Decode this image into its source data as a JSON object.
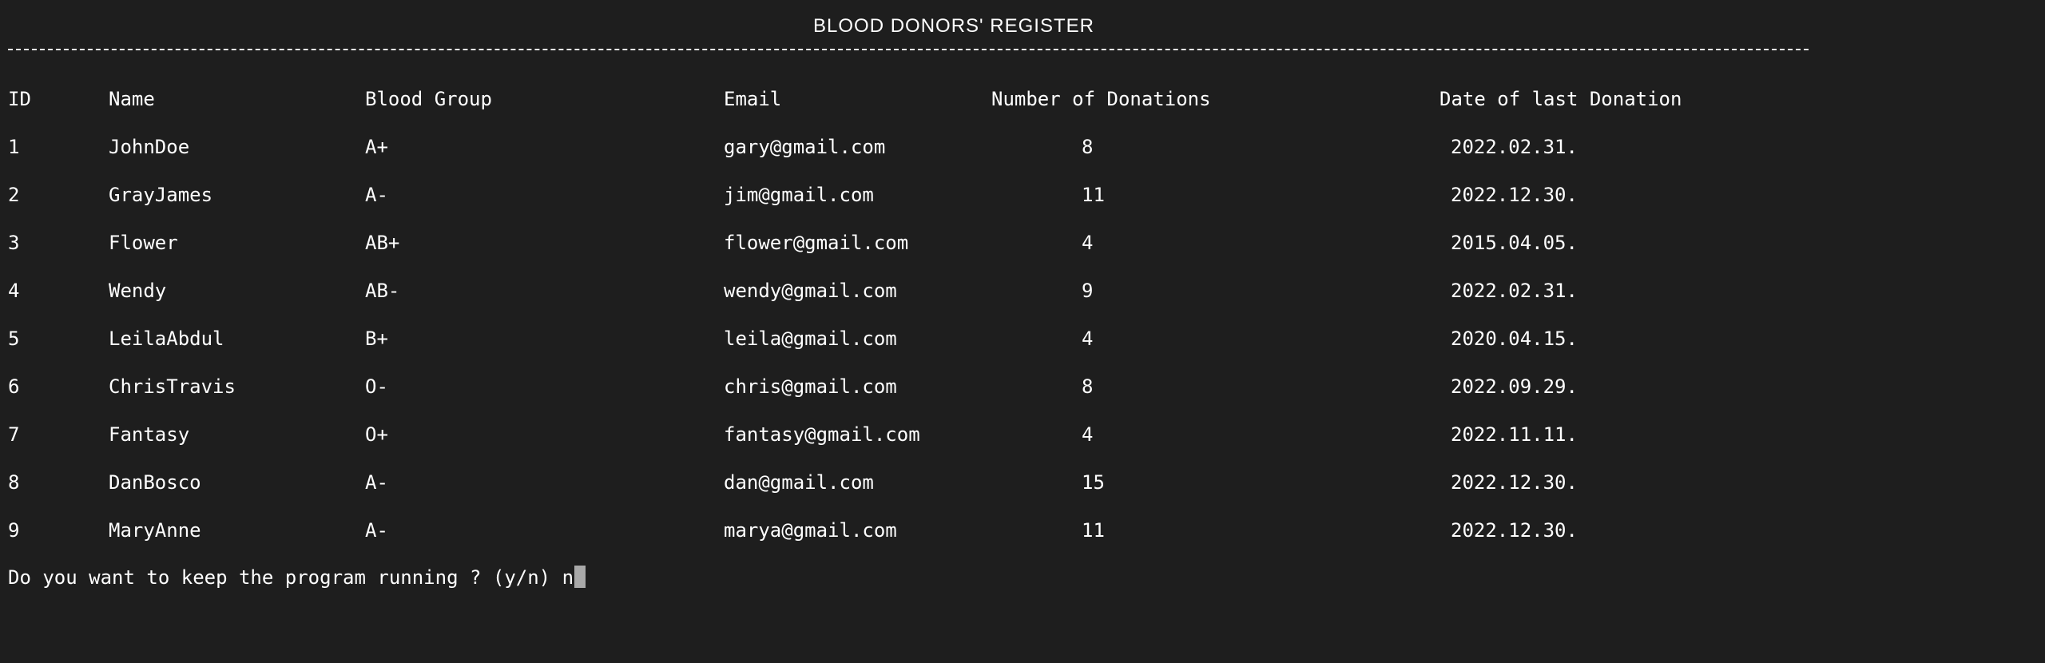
{
  "title": "BLOOD DONORS' REGISTER",
  "headers": {
    "id": "ID",
    "name": "Name",
    "blood_group": "Blood Group",
    "email": "Email",
    "donations": "Number of Donations",
    "last_date": "Date of last Donation"
  },
  "rows": [
    {
      "id": "1",
      "name": "JohnDoe",
      "blood_group": "A+",
      "email": "gary@gmail.com",
      "donations": "8",
      "last_date": "2022.02.31."
    },
    {
      "id": "2",
      "name": "GrayJames",
      "blood_group": "A-",
      "email": "jim@gmail.com",
      "donations": "11",
      "last_date": "2022.12.30."
    },
    {
      "id": "3",
      "name": "Flower",
      "blood_group": "AB+",
      "email": "flower@gmail.com",
      "donations": "4",
      "last_date": "2015.04.05."
    },
    {
      "id": "4",
      "name": "Wendy",
      "blood_group": "AB-",
      "email": "wendy@gmail.com",
      "donations": "9",
      "last_date": "2022.02.31."
    },
    {
      "id": "5",
      "name": "LeilaAbdul",
      "blood_group": "B+",
      "email": "leila@gmail.com",
      "donations": "4",
      "last_date": "2020.04.15."
    },
    {
      "id": "6",
      "name": "ChrisTravis",
      "blood_group": "O-",
      "email": "chris@gmail.com",
      "donations": "8",
      "last_date": "2022.09.29."
    },
    {
      "id": "7",
      "name": "Fantasy",
      "blood_group": "O+",
      "email": "fantasy@gmail.com",
      "donations": "4",
      "last_date": "2022.11.11."
    },
    {
      "id": "8",
      "name": "DanBosco",
      "blood_group": "A-",
      "email": "dan@gmail.com",
      "donations": "15",
      "last_date": "2022.12.30."
    },
    {
      "id": "9",
      "name": "MaryAnne",
      "blood_group": "A-",
      "email": "marya@gmail.com",
      "donations": "11",
      "last_date": "2022.12.30."
    }
  ],
  "prompt": {
    "text": "Do you want to keep the program running ? (y/n) ",
    "input": "n"
  },
  "colors": {
    "background": "#1e1e1e",
    "text": "#ffffff",
    "cursor": "#a9a9a9"
  }
}
